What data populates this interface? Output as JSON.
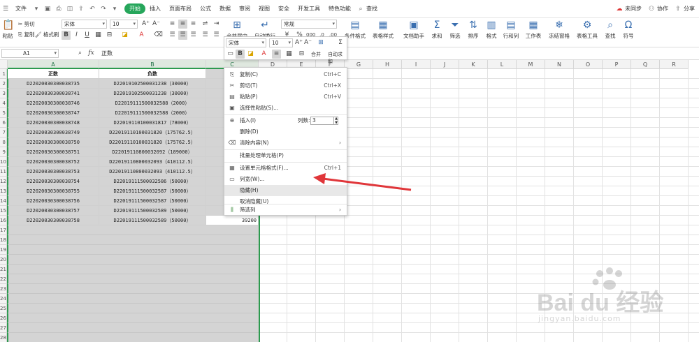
{
  "menubar": {
    "file": "文件",
    "tabs": [
      "开始",
      "插入",
      "页面布局",
      "公式",
      "数据",
      "审阅",
      "视图",
      "安全",
      "开发工具",
      "特色功能"
    ],
    "active_tab": "开始",
    "search": "查找",
    "sync": "未同步",
    "collab": "协作",
    "share": "分享"
  },
  "ribbon": {
    "paste": "粘贴",
    "cut": "剪切",
    "copy": "复制",
    "format_painter": "格式刷",
    "font_name": "宋体",
    "font_size": "10",
    "merge_center": "合并居中",
    "wrap_text": "自动换行",
    "number_format": "常规",
    "conditional_format": "条件格式",
    "table_style": "表格样式",
    "doc_assistant": "文档助手",
    "sum": "求和",
    "filter": "筛选",
    "sort": "排序",
    "format": "格式",
    "rows_cols": "行和列",
    "worksheet": "工作表",
    "freeze": "冻结窗格",
    "table_tools": "表格工具",
    "find": "查找",
    "symbol": "符号"
  },
  "formula_bar": {
    "name_box": "A1",
    "fx": "fx",
    "content": "正数"
  },
  "mini_toolbar": {
    "font_name": "宋体",
    "font_size": "10",
    "merge": "合并",
    "autosum": "自动求和"
  },
  "columns": [
    "A",
    "B",
    "C",
    "D",
    "E",
    "F",
    "G",
    "H",
    "I",
    "J",
    "K",
    "L",
    "M",
    "N",
    "O",
    "P",
    "Q",
    "R"
  ],
  "table": {
    "header": [
      "正数",
      "负数"
    ],
    "rows": [
      [
        "D22020030300038735",
        "D22019102500031238（30000）"
      ],
      [
        "D22020030300038741",
        "D22019102500031238（30000）"
      ],
      [
        "D22020030300038746",
        "D22019111500032588（2000）"
      ],
      [
        "D22020030300038747",
        "D22019111500032588（2000）"
      ],
      [
        "D22020030300038748",
        "D22019110100031817（78000）"
      ],
      [
        "D22020030300038749",
        "D22019110100031820（175762.5）"
      ],
      [
        "D22020030300038750",
        "D22019110100031820（175762.5）"
      ],
      [
        "D22020030300038751",
        "D22019110800032092（189000）"
      ],
      [
        "D22020030300038752",
        "D22019110800032093（410112.5）"
      ],
      [
        "D22020030300038753",
        "D22019110800032093（410112.5）"
      ],
      [
        "D22020030300038754",
        "D22019111500032586（50000）"
      ],
      [
        "D22020030300038755",
        "D22019111500032587（50000）"
      ],
      [
        "D22020030300038756",
        "D22019111500032587（50000）"
      ],
      [
        "D22020030300038757",
        "D22019111500032589（50000）"
      ],
      [
        "D22020030300038758",
        "D22019111500032589（50000）"
      ]
    ],
    "c16": "39200"
  },
  "context_menu": {
    "copy": "复制(C)",
    "copy_sc": "Ctrl+C",
    "cut": "剪切(T)",
    "cut_sc": "Ctrl+X",
    "paste": "粘贴(P)",
    "paste_sc": "Ctrl+V",
    "paste_special": "选择性粘贴(S)...",
    "insert": "插入(I)",
    "insert_count_label": "列数:",
    "insert_count": "3",
    "delete": "删除(D)",
    "clear": "清除内容(N)",
    "batch": "批量处理单元格(P)",
    "format_cells": "设置单元格格式(F)...",
    "format_cells_sc": "Ctrl+1",
    "col_width": "列宽(W)...",
    "hide": "隐藏(H)",
    "unhide": "取消隐藏(U)",
    "filter_col": "筛选列"
  },
  "watermark": {
    "brand": "Bai du 经验",
    "url": "jingyan.baidu.com"
  },
  "colors": {
    "accent_green": "#26a65b",
    "selection_fill": "#d4d4d4",
    "selection_border": "#2d9a4f",
    "arrow_red": "#e0363a"
  }
}
